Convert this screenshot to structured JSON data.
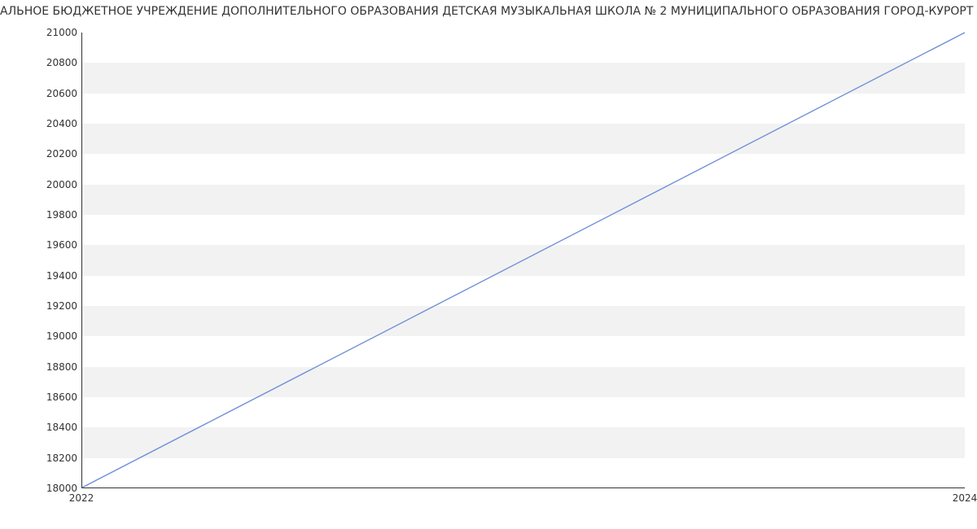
{
  "chart_data": {
    "type": "line",
    "title": "АЛЬНОЕ БЮДЖЕТНОЕ УЧРЕЖДЕНИЕ ДОПОЛНИТЕЛЬНОГО ОБРАЗОВАНИЯ ДЕТСКАЯ МУЗЫКАЛЬНАЯ ШКОЛА № 2 МУНИЦИПАЛЬНОГО ОБРАЗОВАНИЯ ГОРОД-КУРОРТ АНАПА",
    "xlabel": "",
    "ylabel": "",
    "x_ticks": [
      2022,
      2024
    ],
    "y_ticks": [
      18000,
      18200,
      18400,
      18600,
      18800,
      19000,
      19200,
      19400,
      19600,
      19800,
      20000,
      20200,
      20400,
      20600,
      20800,
      21000
    ],
    "xlim": [
      2022,
      2024
    ],
    "ylim": [
      18000,
      21000
    ],
    "series": [
      {
        "name": "value",
        "color": "#6f8fd8",
        "x": [
          2022,
          2024
        ],
        "y": [
          18000,
          21000
        ]
      }
    ],
    "grid_bands": true
  }
}
